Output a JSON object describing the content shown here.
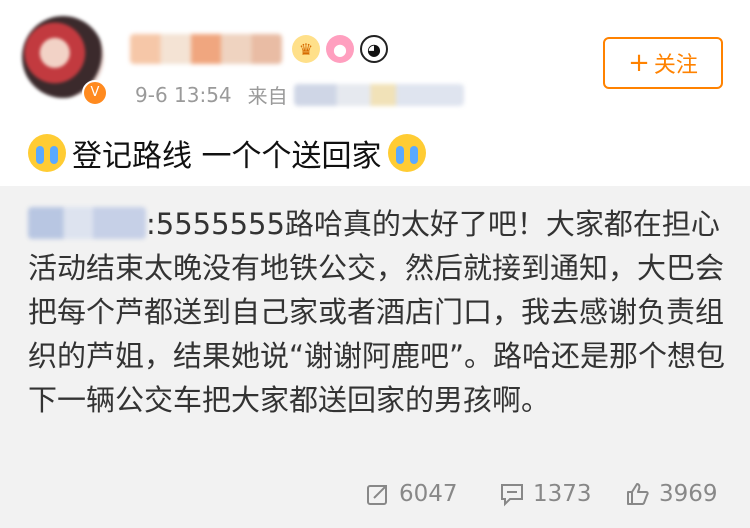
{
  "post": {
    "username": "••••••••",
    "badges": [
      "crown-badge-icon",
      "donut-badge-icon",
      "panda-badge-icon"
    ],
    "time": "9-6 13:54",
    "source_prefix": "来自",
    "source_name": "••••••",
    "follow_label": "关注",
    "follow_plus": "+",
    "text": "登记路线 一个个送回家"
  },
  "repost": {
    "origin_name": "•••••",
    "body": ":5555555路哈真的太好了吧！大家都在担心活动结束太晚没有地铁公交，然后就接到通知，大巴会把每个芦都送到自己家或者酒店门口，我去感谢负责组织的芦姐，结果她说“谢谢阿鹿吧”。路哈还是那个想包下一辆公交车把大家都送回家的男孩啊。"
  },
  "actions": {
    "repost_count": "6047",
    "comment_count": "1373",
    "like_count": "3969"
  },
  "colors": {
    "accent": "#ff8200",
    "repost_bg": "#f2f2f2",
    "meta": "#9a9a9a"
  }
}
